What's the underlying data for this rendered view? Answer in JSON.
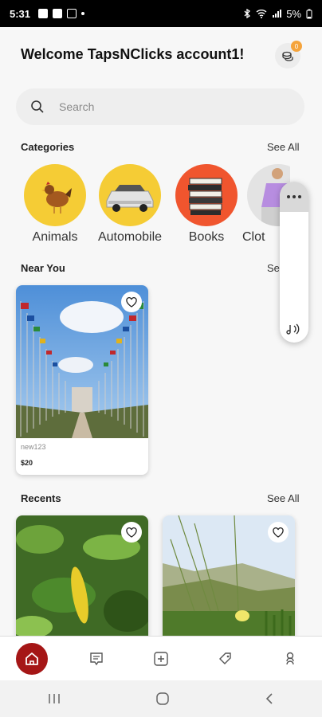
{
  "status_bar": {
    "time": "5:31",
    "battery": "5%"
  },
  "header": {
    "welcome": "Welcome TapsNClicks account1!",
    "notification_count": "0"
  },
  "search": {
    "placeholder": "Search"
  },
  "categories": {
    "title": "Categories",
    "see_all": "See All",
    "items": [
      {
        "label": "Animals",
        "color": "#f5cc35"
      },
      {
        "label": "Automobile",
        "color": "#f5cc35"
      },
      {
        "label": "Books",
        "color": "#f0552e"
      },
      {
        "label": "Clot",
        "color": "#e3e3e3"
      }
    ]
  },
  "near_you": {
    "title": "Near You",
    "see_all": "Se",
    "items": [
      {
        "title": "new123",
        "price": "$20"
      }
    ]
  },
  "recents": {
    "title": "Recents",
    "see_all": "See All"
  },
  "colors": {
    "accent": "#a51616",
    "badge": "#f5a43c"
  },
  "bottom_nav": [
    "home-icon",
    "chat-icon",
    "add-icon",
    "tag-icon",
    "profile-icon"
  ]
}
